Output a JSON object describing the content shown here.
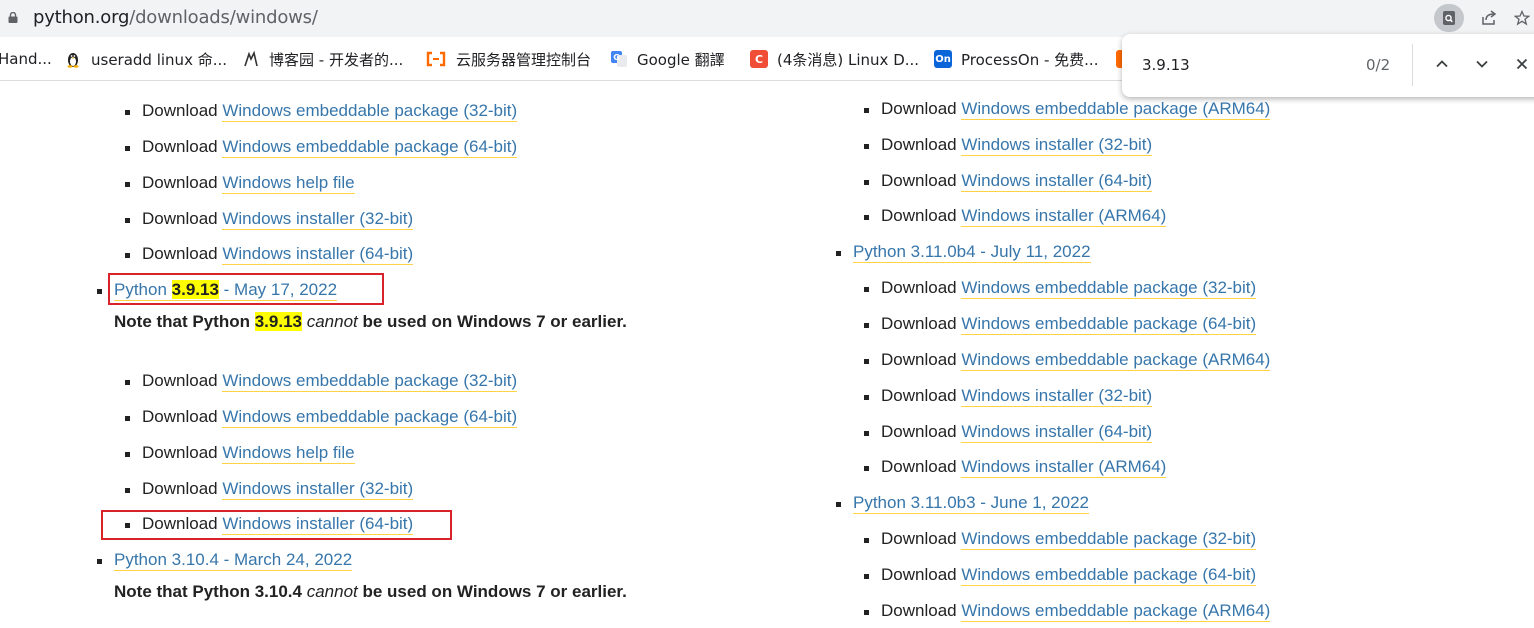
{
  "browser": {
    "url_host": "python.org",
    "url_path": "/downloads/windows/"
  },
  "bookmarks": [
    {
      "label": "Hand...",
      "icon": ""
    },
    {
      "label": "useradd linux 命...",
      "icon": "linux-penguin-icon"
    },
    {
      "label": "博客园 - 开发者的...",
      "icon": "cnblogs-icon"
    },
    {
      "label": "云服务器管理控制台",
      "icon": "aliyun-icon"
    },
    {
      "label": "Google 翻譯",
      "icon": "google-translate-icon"
    },
    {
      "label": "(4条消息) Linux D...",
      "icon": "csdn-icon",
      "icon_text": "C"
    },
    {
      "label": "ProcessOn - 免费...",
      "icon": "processon-icon",
      "icon_text": "On"
    }
  ],
  "find": {
    "query": "3.9.13",
    "count": "0/2"
  },
  "common": {
    "download": "Download"
  },
  "left_top_links": [
    "Windows embeddable package (32-bit)",
    "Windows embeddable package (64-bit)",
    "Windows help file",
    "Windows installer (32-bit)",
    "Windows installer (64-bit)"
  ],
  "release_3913": {
    "prefix": "Python ",
    "version": "3.9.13",
    "suffix": " - May 17, 2022",
    "note_prefix": "Note that Python ",
    "note_version": "3.9.13",
    "note_cannot": "cannot",
    "note_suffix": " be used on Windows 7 or earlier.",
    "links": [
      "Windows embeddable package (32-bit)",
      "Windows embeddable package (64-bit)",
      "Windows help file",
      "Windows installer (32-bit)",
      "Windows installer (64-bit)"
    ]
  },
  "release_3104": {
    "title": "Python 3.10.4 - March 24, 2022",
    "note_prefix": "Note that Python 3.10.4 ",
    "note_cannot": "cannot",
    "note_suffix": " be used on Windows 7 or earlier."
  },
  "right_top_links": [
    "Windows embeddable package (ARM64)",
    "Windows installer (32-bit)",
    "Windows installer (64-bit)",
    "Windows installer (ARM64)"
  ],
  "release_3110b4": {
    "title": "Python 3.11.0b4 - July 11, 2022",
    "links": [
      "Windows embeddable package (32-bit)",
      "Windows embeddable package (64-bit)",
      "Windows embeddable package (ARM64)",
      "Windows installer (32-bit)",
      "Windows installer (64-bit)",
      "Windows installer (ARM64)"
    ]
  },
  "release_3110b3": {
    "title": "Python 3.11.0b3 - June 1, 2022",
    "links": [
      "Windows embeddable package (32-bit)",
      "Windows embeddable package (64-bit)",
      "Windows embeddable package (ARM64)"
    ]
  },
  "colors": {
    "link": "#3776ab",
    "underline": "#ffd343",
    "highlight": "#ffff00",
    "annotation_box": "#d9232a"
  }
}
